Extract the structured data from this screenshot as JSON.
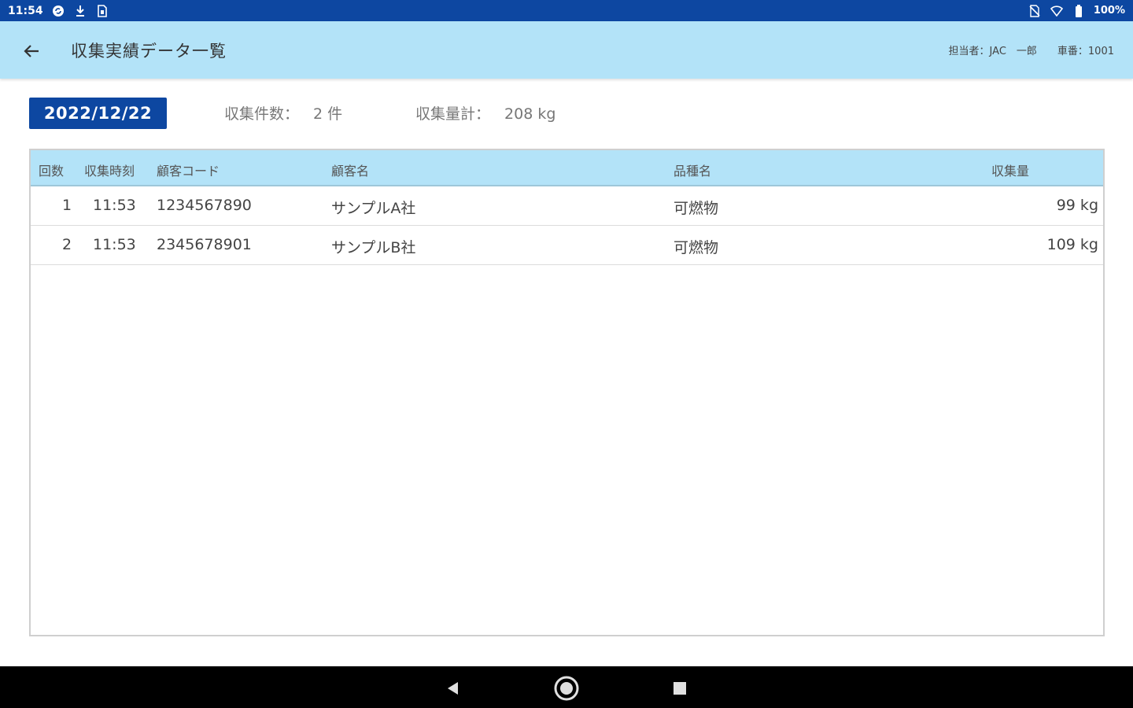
{
  "status_bar": {
    "time": "11:54",
    "left_icons": [
      "sync-icon",
      "download-icon",
      "sim-icon"
    ],
    "right_icons": [
      "no-sim-icon",
      "wifi-icon",
      "battery-icon"
    ],
    "battery": "100%"
  },
  "app_bar": {
    "title": "収集実績データ一覧",
    "operator": "担当者：JAC　一郎",
    "vehicle": "車番：1001"
  },
  "summary": {
    "date": "2022/12/22",
    "count_label": "収集件数：",
    "count_value": "2 件",
    "weight_label": "収集量計：",
    "weight_value": "208 kg"
  },
  "table": {
    "columns": [
      "回数",
      "収集時刻",
      "顧客コード",
      "顧客名",
      "品種名",
      "収集量"
    ],
    "rows": [
      {
        "no": "1",
        "time": "11:53",
        "code": "1234567890",
        "name": "サンプルA社",
        "item": "可燃物",
        "amount": "99 kg"
      },
      {
        "no": "2",
        "time": "11:53",
        "code": "2345678901",
        "name": "サンプルB社",
        "item": "可燃物",
        "amount": "109 kg"
      }
    ]
  },
  "nav": {
    "icons": [
      "back-triangle-icon",
      "home-circle-icon",
      "recents-square-icon"
    ]
  },
  "colors": {
    "primary": "#0d47a1",
    "header_bg": "#b3e3f8"
  }
}
